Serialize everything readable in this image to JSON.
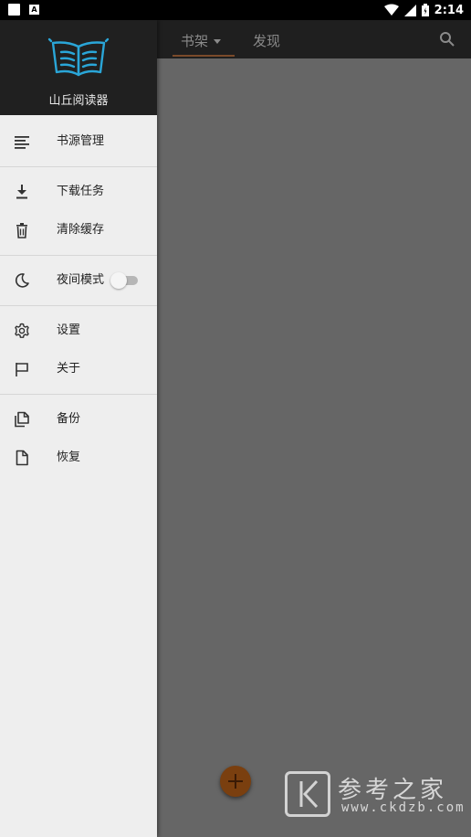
{
  "status_bar": {
    "time": "2:14",
    "notif_letter": "A"
  },
  "drawer": {
    "app_name": "山丘阅读器",
    "items": [
      {
        "label": "书源管理",
        "icon": "list-icon"
      },
      {
        "label": "下载任务",
        "icon": "download-icon"
      },
      {
        "label": "清除缓存",
        "icon": "trash-icon"
      },
      {
        "label": "夜间模式",
        "icon": "moon-icon",
        "toggle": false
      },
      {
        "label": "设置",
        "icon": "gear-icon"
      },
      {
        "label": "关于",
        "icon": "flag-icon"
      },
      {
        "label": "备份",
        "icon": "copy-icon"
      },
      {
        "label": "恢复",
        "icon": "file-icon"
      }
    ]
  },
  "toolbar": {
    "tabs": [
      {
        "label": "书架"
      },
      {
        "label": "发现"
      }
    ]
  },
  "watermark": {
    "title": "参考之家",
    "url": "www.ckdzb.com"
  }
}
